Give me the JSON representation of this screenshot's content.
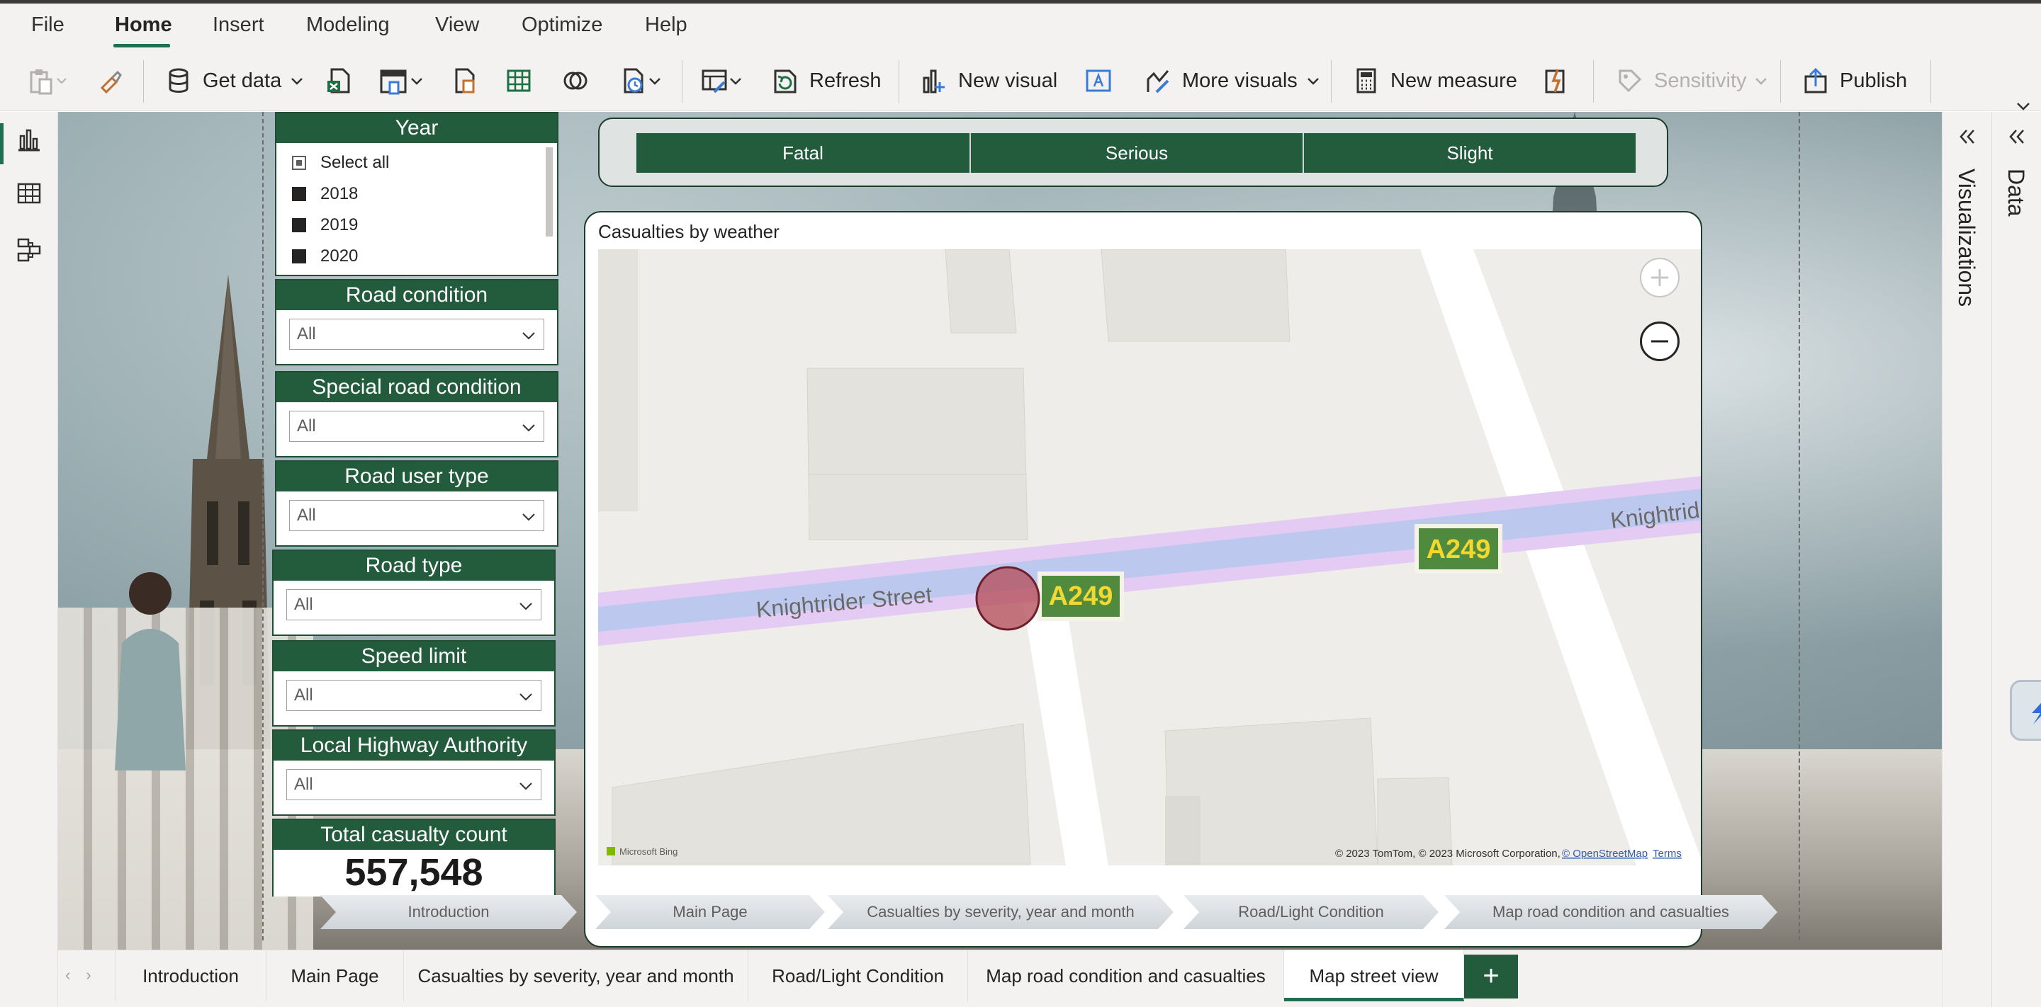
{
  "menu": {
    "items": [
      "File",
      "Home",
      "Insert",
      "Modeling",
      "View",
      "Optimize",
      "Help"
    ],
    "active": "Home"
  },
  "ribbon": {
    "get_data": "Get data",
    "refresh": "Refresh",
    "new_visual": "New visual",
    "more_visuals": "More visuals",
    "new_measure": "New measure",
    "sensitivity": "Sensitivity",
    "publish": "Publish"
  },
  "slicers": {
    "year": {
      "title": "Year",
      "options": [
        "Select all",
        "2018",
        "2019",
        "2020"
      ]
    },
    "road_condition": {
      "title": "Road condition",
      "value": "All"
    },
    "special_road_condition": {
      "title": "Special road condition",
      "value": "All"
    },
    "road_user_type": {
      "title": "Road user type",
      "value": "All"
    },
    "road_type": {
      "title": "Road type",
      "value": "All"
    },
    "speed_limit": {
      "title": "Speed limit",
      "value": "All"
    },
    "local_highway_authority": {
      "title": "Local Highway Authority",
      "value": "All"
    }
  },
  "kpi": {
    "title": "Total casualty count",
    "value": "557,548"
  },
  "severity": [
    "Fatal",
    "Serious",
    "Slight"
  ],
  "map": {
    "title": "Casualties by weather",
    "street_name": "Knightrider Street",
    "street_name_right": "Knightrid",
    "road_shield": "A249",
    "bing_label": "Microsoft Bing",
    "copyright": "© 2023 TomTom, © 2023 Microsoft Corporation,",
    "osm_link": "© OpenStreetMap",
    "terms": "Terms"
  },
  "nav_buttons": [
    "Introduction",
    "Main Page",
    "Casualties by severity, year and month",
    "Road/Light Condition",
    "Map road condition and casualties"
  ],
  "page_tabs": [
    "Introduction",
    "Main Page",
    "Casualties by severity, year and month",
    "Road/Light Condition",
    "Map road condition and casualties",
    "Map street view"
  ],
  "active_tab": "Map street view",
  "add_tab": "+",
  "panes": {
    "visualizations": "Visualizations",
    "data": "Data"
  },
  "colors": {
    "accent": "#1f6f54",
    "slicer_header": "#235b3d",
    "bubble": "#b5525e"
  }
}
